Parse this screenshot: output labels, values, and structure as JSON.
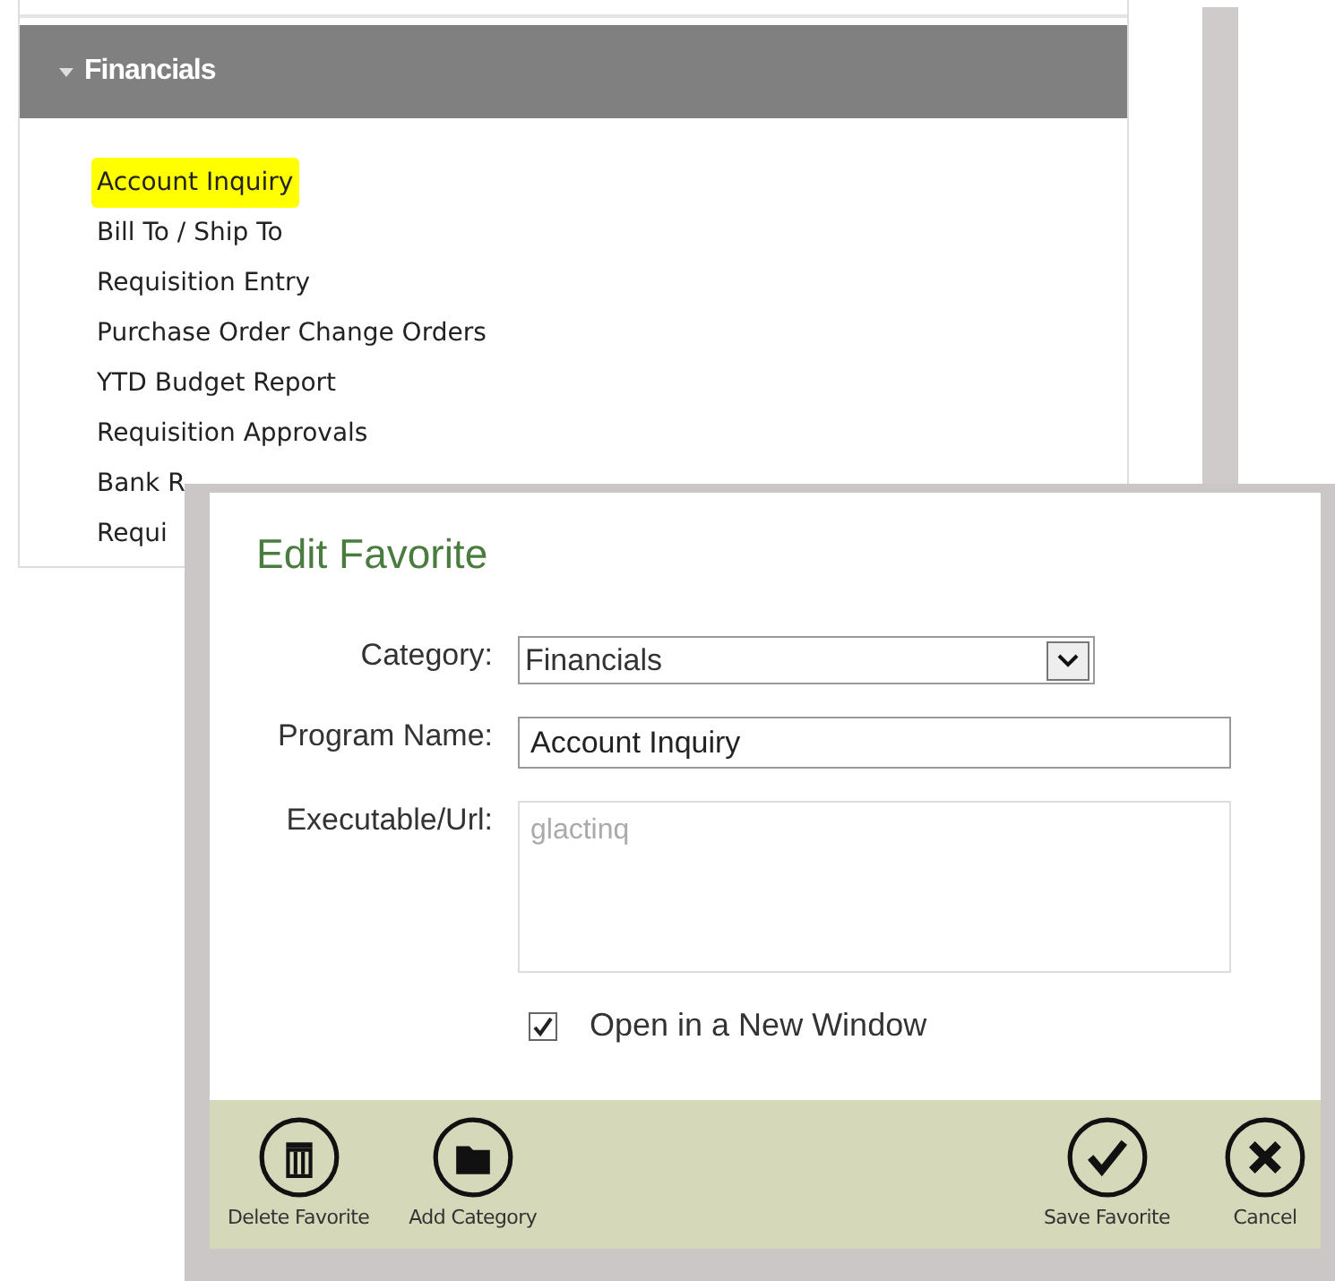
{
  "menu_panel": {
    "header": {
      "label": "Financials",
      "expanded": true
    },
    "items": [
      {
        "label": "Account Inquiry",
        "selected": true
      },
      {
        "label": "Bill To / Ship To",
        "selected": false
      },
      {
        "label": "Requisition Entry",
        "selected": false
      },
      {
        "label": "Purchase Order Change Orders",
        "selected": false
      },
      {
        "label": "YTD Budget Report",
        "selected": false
      },
      {
        "label": "Requisition Approvals",
        "selected": false
      },
      {
        "label": "Bank R",
        "selected": false
      },
      {
        "label": "Requi",
        "selected": false
      }
    ]
  },
  "dialog": {
    "title": "Edit Favorite",
    "fields": [
      {
        "kind": "select",
        "label": "Category:",
        "value": "Financials",
        "disabled": false
      },
      {
        "kind": "text",
        "label": "Program Name:",
        "value": "Account Inquiry",
        "disabled": false
      },
      {
        "kind": "textarea",
        "label": "Executable/Url:",
        "value": "glactinq",
        "disabled": true
      }
    ],
    "checkbox": {
      "label": "Open in a New Window",
      "checked": true
    },
    "buttons": [
      {
        "kind": "delete",
        "label": "Delete Favorite"
      },
      {
        "kind": "folder",
        "label": "Add Category"
      },
      {
        "kind": "save",
        "label": "Save Favorite"
      },
      {
        "kind": "cancel",
        "label": "Cancel"
      }
    ]
  }
}
